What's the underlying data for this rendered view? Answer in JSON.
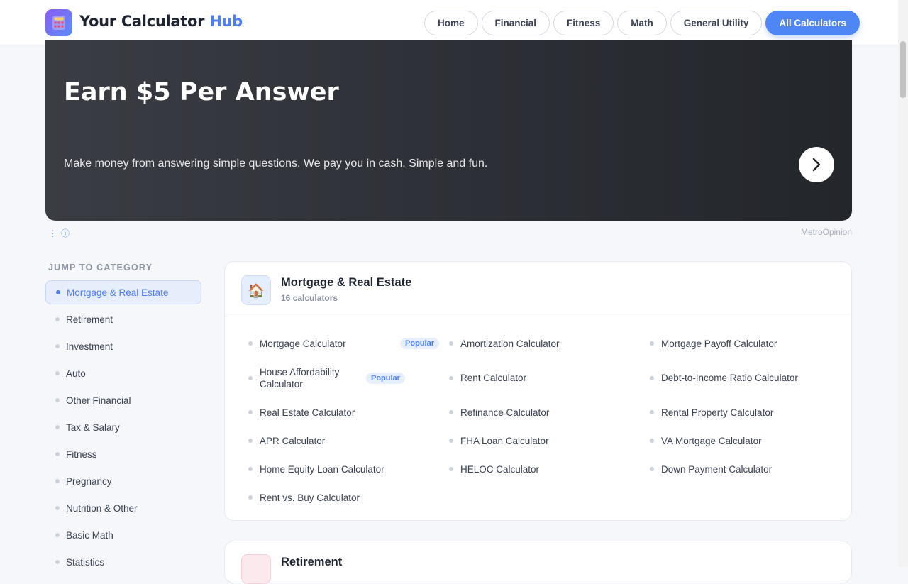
{
  "header": {
    "brand_main": "Your Calculator",
    "brand_accent": "Hub",
    "nav": [
      {
        "label": "Home",
        "active": false
      },
      {
        "label": "Financial",
        "active": false
      },
      {
        "label": "Fitness",
        "active": false
      },
      {
        "label": "Math",
        "active": false
      },
      {
        "label": "General Utility",
        "active": false
      },
      {
        "label": "All Calculators",
        "active": true
      }
    ]
  },
  "ad": {
    "title": "Earn $5 Per Answer",
    "text": "Make money from answering simple questions. We pay you in cash. Simple and fun.",
    "advertiser": "MetroOpinion"
  },
  "sidebar": {
    "title": "JUMP TO CATEGORY",
    "items": [
      {
        "label": "Mortgage & Real Estate",
        "active": true
      },
      {
        "label": "Retirement",
        "active": false
      },
      {
        "label": "Investment",
        "active": false
      },
      {
        "label": "Auto",
        "active": false
      },
      {
        "label": "Other Financial",
        "active": false
      },
      {
        "label": "Tax & Salary",
        "active": false
      },
      {
        "label": "Fitness",
        "active": false
      },
      {
        "label": "Pregnancy",
        "active": false
      },
      {
        "label": "Nutrition & Other",
        "active": false
      },
      {
        "label": "Basic Math",
        "active": false
      },
      {
        "label": "Statistics",
        "active": false
      }
    ]
  },
  "category": {
    "icon": "house-icon",
    "title": "Mortgage & Real Estate",
    "count": "16 calculators",
    "calculators": [
      {
        "label": "Mortgage Calculator",
        "badge": "Popular"
      },
      {
        "label": "Amortization Calculator",
        "badge": ""
      },
      {
        "label": "Mortgage Payoff Calculator",
        "badge": ""
      },
      {
        "label": "House Affordability Calculator",
        "badge": "Popular"
      },
      {
        "label": "Rent Calculator",
        "badge": ""
      },
      {
        "label": "Debt-to-Income Ratio Calculator",
        "badge": ""
      },
      {
        "label": "Real Estate Calculator",
        "badge": ""
      },
      {
        "label": "Refinance Calculator",
        "badge": ""
      },
      {
        "label": "Rental Property Calculator",
        "badge": ""
      },
      {
        "label": "APR Calculator",
        "badge": ""
      },
      {
        "label": "FHA Loan Calculator",
        "badge": ""
      },
      {
        "label": "VA Mortgage Calculator",
        "badge": ""
      },
      {
        "label": "Home Equity Loan Calculator",
        "badge": ""
      },
      {
        "label": "HELOC Calculator",
        "badge": ""
      },
      {
        "label": "Down Payment Calculator",
        "badge": ""
      },
      {
        "label": "Rent vs. Buy Calculator",
        "badge": ""
      }
    ]
  },
  "next_category": {
    "title": "Retirement"
  },
  "colors": {
    "accent": "#4f86f5",
    "brand_accent": "#4f7df0",
    "ad_bg": "#2c2f35"
  }
}
